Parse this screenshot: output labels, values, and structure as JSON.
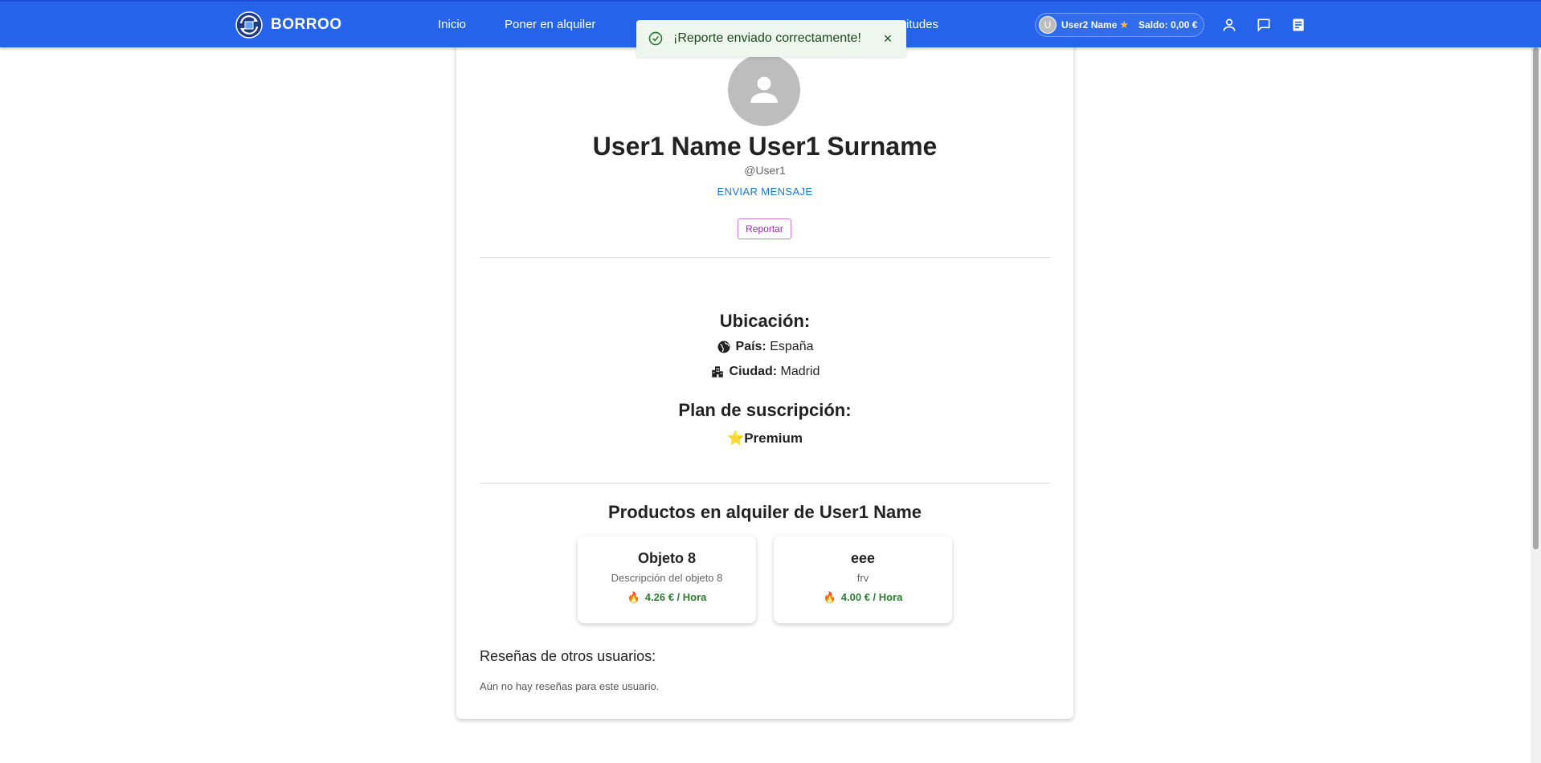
{
  "navbar": {
    "brand": "BORROO",
    "links": [
      "Inicio",
      "Poner en alquiler",
      "itudes"
    ],
    "user": {
      "avatar_initial": "U",
      "name": "User2 Name",
      "balance": "Saldo: 0,00 €"
    },
    "icons": [
      "user-icon",
      "chat-icon",
      "notes-icon"
    ],
    "color": "#2563eb"
  },
  "toast": {
    "message": "¡Reporte enviado correctamente!",
    "close": "×",
    "type": "success"
  },
  "profile": {
    "full_name": "User1 Name User1 Surname",
    "username": "@User1",
    "send_message": "ENVIAR MENSAJE",
    "report": "Reportar"
  },
  "location": {
    "title": "Ubicación:",
    "country_label": "País:",
    "country": "España",
    "city_label": "Ciudad:",
    "city": "Madrid"
  },
  "subscription": {
    "title": "Plan de suscripción:",
    "star": "⭐",
    "plan": "Premium"
  },
  "products": {
    "title": "Productos en alquiler de User1 Name",
    "items": [
      {
        "name": "Objeto 8",
        "description": "Descripción del objeto 8",
        "price": "4.26 € / Hora"
      },
      {
        "name": "eee",
        "description": "frv",
        "price": "4.00 € / Hora"
      }
    ]
  },
  "reviews": {
    "title": "Reseñas de otros usuarios:",
    "empty": "Aún no hay reseñas para este usuario."
  }
}
